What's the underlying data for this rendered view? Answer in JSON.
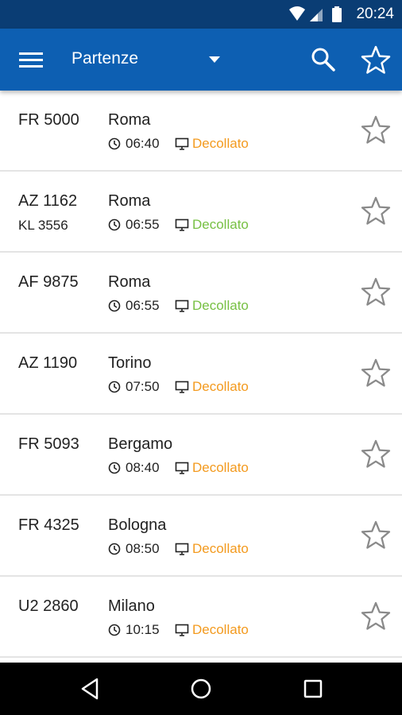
{
  "status_bar": {
    "time": "20:24",
    "icons": [
      "wifi-icon",
      "signal-icon",
      "battery-icon"
    ]
  },
  "app_bar": {
    "title": "Partenze",
    "icons": [
      "menu-icon",
      "dropdown-caret-icon",
      "search-icon",
      "star-outline-icon"
    ]
  },
  "flights": [
    {
      "code": "FR 5000",
      "code2": "",
      "city": "Roma",
      "time": "06:40",
      "status": "Decollato",
      "status_color": "#f39a1e"
    },
    {
      "code": "AZ 1162",
      "code2": "KL 3556",
      "city": "Roma",
      "time": "06:55",
      "status": "Decollato",
      "status_color": "#77c043"
    },
    {
      "code": "AF 9875",
      "code2": "",
      "city": "Roma",
      "time": "06:55",
      "status": "Decollato",
      "status_color": "#77c043"
    },
    {
      "code": "AZ 1190",
      "code2": "",
      "city": "Torino",
      "time": "07:50",
      "status": "Decollato",
      "status_color": "#f39a1e"
    },
    {
      "code": "FR 5093",
      "code2": "",
      "city": "Bergamo",
      "time": "08:40",
      "status": "Decollato",
      "status_color": "#f39a1e"
    },
    {
      "code": "FR 4325",
      "code2": "",
      "city": "Bologna",
      "time": "08:50",
      "status": "Decollato",
      "status_color": "#f39a1e"
    },
    {
      "code": "U2 2860",
      "code2": "",
      "city": "Milano",
      "time": "10:15",
      "status": "Decollato",
      "status_color": "#f39a1e"
    }
  ],
  "nav_bar": {
    "icons": [
      "back-icon",
      "home-icon",
      "recents-icon"
    ]
  },
  "colors": {
    "status_bar": "#0a3d74",
    "app_bar": "#0d5fb2",
    "status_orange": "#f39a1e",
    "status_green": "#77c043"
  }
}
